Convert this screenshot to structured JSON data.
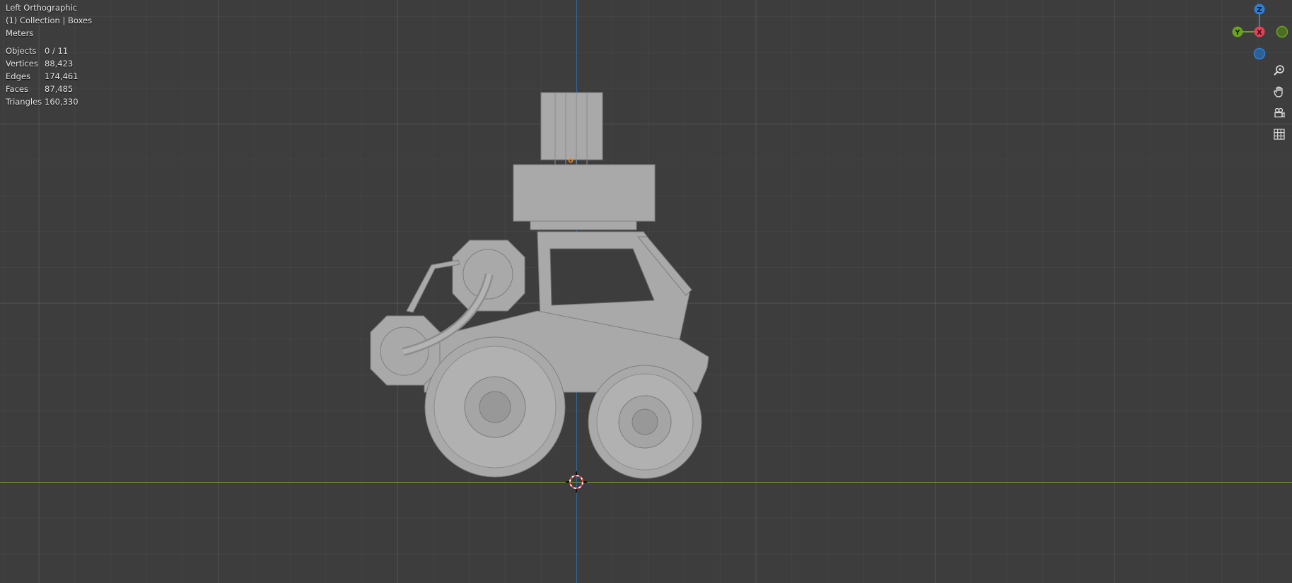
{
  "viewport": {
    "view_name": "Left Orthographic",
    "collection_info": "(1) Collection | Boxes",
    "units": "Meters",
    "stats": [
      {
        "label": "Objects",
        "value": "0 / 11"
      },
      {
        "label": "Vertices",
        "value": "88,423"
      },
      {
        "label": "Edges",
        "value": "174,461"
      },
      {
        "label": "Faces",
        "value": "87,485"
      },
      {
        "label": "Triangles",
        "value": "160,330"
      }
    ]
  },
  "gizmo": {
    "z_label": "Z",
    "y_label": "Y",
    "x_label": "X",
    "colors": {
      "z": "#2f7fd8",
      "y": "#6aa321",
      "x": "#e34256"
    }
  },
  "nav_icons": [
    "zoom-icon",
    "hand-pan-icon",
    "camera-icon",
    "grid-icon"
  ],
  "colors": {
    "background": "#3d3d3d",
    "model": "#a9a9a9",
    "x_axis_line": "#6a9a2a",
    "z_axis_line": "#2c6fb0"
  }
}
